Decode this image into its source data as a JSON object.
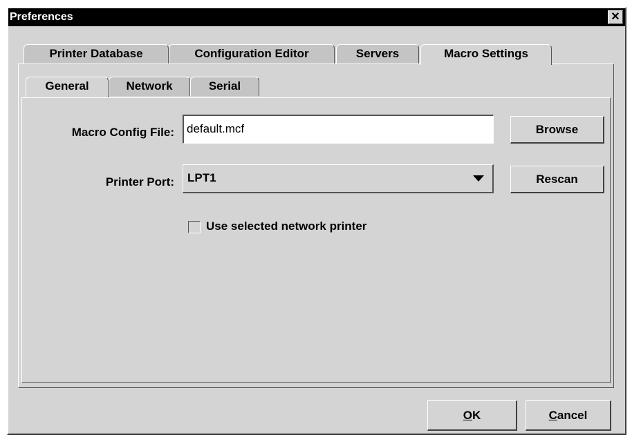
{
  "window": {
    "title": "Preferences"
  },
  "outer_tabs": [
    {
      "label": "Printer Database",
      "selected": false
    },
    {
      "label": "Configuration Editor",
      "selected": false
    },
    {
      "label": "Servers",
      "selected": false
    },
    {
      "label": "Macro Settings",
      "selected": true
    }
  ],
  "inner_tabs": [
    {
      "label": "General",
      "selected": true
    },
    {
      "label": "Network",
      "selected": false
    },
    {
      "label": "Serial",
      "selected": false
    }
  ],
  "form": {
    "macro_config_label": "Macro Config File:",
    "macro_config_value": "default.mcf",
    "browse_label": "Browse",
    "printer_port_label": "Printer Port:",
    "printer_port_value": "LPT1",
    "rescan_label": "Rescan",
    "use_network_label": "Use selected network printer",
    "use_network_checked": false
  },
  "buttons": {
    "ok_mnemonic": "O",
    "ok_rest": "K",
    "cancel_mnemonic": "C",
    "cancel_rest": "ancel"
  },
  "icons": {
    "close": "close-icon",
    "dropdown": "chevron-down-icon",
    "checkbox": "checkbox-unchecked-icon"
  },
  "colors": {
    "title_bar": "#000000",
    "panel": "#d4d4d4",
    "tab_unselected": "#c4c4c4"
  }
}
